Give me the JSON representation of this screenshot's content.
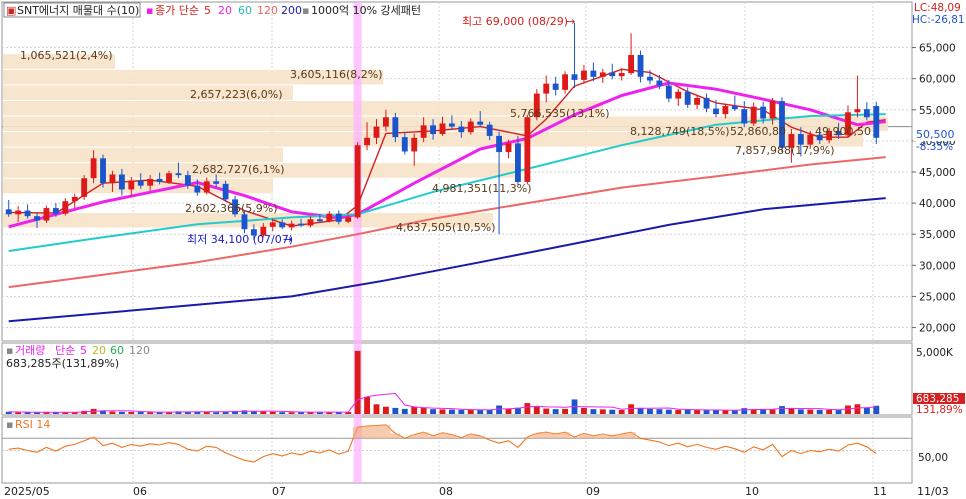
{
  "header": {
    "title": "SNT에너지 매물대 수(10)",
    "ma_label": "종가 단순",
    "ma_periods": [
      "5",
      "20",
      "60",
      "120",
      "200"
    ],
    "ma_colors": [
      "#d32020",
      "#ee22ee",
      "#22cccc",
      "#ee6666",
      "#1a1aaa"
    ],
    "pattern_label": "1000억 10% 강세패턴",
    "lc": "LC:48,09",
    "hc": "HC:-26,81"
  },
  "price_axis": {
    "ticks": [
      "65,000",
      "60,000",
      "55,000",
      "50,000",
      "45,000",
      "40,000",
      "35,000",
      "30,000",
      "25,000",
      "20,000"
    ],
    "current_price": "50,500",
    "current_change": "-8.35%"
  },
  "annotations": {
    "high": "최고 69,000 (08/29)",
    "low": "최저 34,100 (07/07)"
  },
  "volume_profile_labels": [
    "1,065,521(2,4%)",
    "3,605,116(8,2%)",
    "2,657,223(6,0%)",
    "5,766,535(13,1%)",
    "8,128,749(18,5%)",
    "52,860,80",
    "49,900,50",
    "7,857,988(17,9%)",
    "2,682,727(6,1%)",
    "4,981,351(11,3%)",
    "2,602,366(5,9%)",
    "4,637,505(10,5%)"
  ],
  "volume_panel": {
    "title": "거래량",
    "ma_label": "단순",
    "ma_periods": [
      "5",
      "20",
      "60",
      "120"
    ],
    "ma_colors": [
      "#ee22ee",
      "#cccc22",
      "#22aa55",
      "#888888"
    ],
    "value_line": "683,285주(131,89%)",
    "axis_tick": "5,000K",
    "last_value": "683,285",
    "last_pct": "131,89%"
  },
  "rsi_panel": {
    "title": "RSI 14",
    "axis_tick": "50,00"
  },
  "x_axis": {
    "labels": [
      "2025/05",
      "06",
      "07",
      "08",
      "09",
      "10",
      "11",
      "11/03"
    ]
  },
  "chart_data": {
    "type": "candlestick",
    "title": "SNT에너지 매물대 수(10)",
    "ylim": [
      18000,
      72000
    ],
    "y_ticks": [
      20000,
      25000,
      30000,
      35000,
      40000,
      45000,
      50000,
      55000,
      60000,
      65000
    ],
    "high": 69000,
    "low": 34100,
    "last_close": 50500,
    "candles": [
      {
        "o": 39000,
        "h": 40500,
        "l": 37800,
        "c": 38200
      },
      {
        "o": 38200,
        "h": 39500,
        "l": 37000,
        "c": 38800
      },
      {
        "o": 38800,
        "h": 39800,
        "l": 37500,
        "c": 37900
      },
      {
        "o": 37900,
        "h": 38500,
        "l": 36000,
        "c": 37200
      },
      {
        "o": 37200,
        "h": 39600,
        "l": 36800,
        "c": 39200
      },
      {
        "o": 39200,
        "h": 40000,
        "l": 37800,
        "c": 38300
      },
      {
        "o": 38300,
        "h": 40800,
        "l": 38000,
        "c": 40300
      },
      {
        "o": 40300,
        "h": 41500,
        "l": 39200,
        "c": 41000
      },
      {
        "o": 41000,
        "h": 44500,
        "l": 40500,
        "c": 44000
      },
      {
        "o": 44000,
        "h": 48500,
        "l": 43200,
        "c": 47200
      },
      {
        "o": 47200,
        "h": 47800,
        "l": 42500,
        "c": 43200
      },
      {
        "o": 43200,
        "h": 45200,
        "l": 41800,
        "c": 44600
      },
      {
        "o": 44600,
        "h": 45500,
        "l": 41200,
        "c": 42200
      },
      {
        "o": 42200,
        "h": 44200,
        "l": 41000,
        "c": 43600
      },
      {
        "o": 43600,
        "h": 44800,
        "l": 42300,
        "c": 42800
      },
      {
        "o": 42800,
        "h": 44500,
        "l": 42000,
        "c": 43900
      },
      {
        "o": 43900,
        "h": 44900,
        "l": 43000,
        "c": 43400
      },
      {
        "o": 43400,
        "h": 45200,
        "l": 43100,
        "c": 44800
      },
      {
        "o": 44800,
        "h": 46500,
        "l": 44000,
        "c": 44500
      },
      {
        "o": 44500,
        "h": 45200,
        "l": 42300,
        "c": 42800
      },
      {
        "o": 42800,
        "h": 43800,
        "l": 41200,
        "c": 41700
      },
      {
        "o": 41700,
        "h": 44100,
        "l": 41400,
        "c": 43500
      },
      {
        "o": 43500,
        "h": 44600,
        "l": 42600,
        "c": 43100
      },
      {
        "o": 43100,
        "h": 43600,
        "l": 40200,
        "c": 40600
      },
      {
        "o": 40600,
        "h": 41200,
        "l": 37800,
        "c": 38200
      },
      {
        "o": 38200,
        "h": 38800,
        "l": 35200,
        "c": 35800
      },
      {
        "o": 35800,
        "h": 36600,
        "l": 34100,
        "c": 34800
      },
      {
        "o": 34800,
        "h": 36800,
        "l": 34500,
        "c": 36200
      },
      {
        "o": 36200,
        "h": 37500,
        "l": 35500,
        "c": 36900
      },
      {
        "o": 36900,
        "h": 37400,
        "l": 35800,
        "c": 36100
      },
      {
        "o": 36100,
        "h": 37200,
        "l": 35600,
        "c": 36700
      },
      {
        "o": 36700,
        "h": 37500,
        "l": 36200,
        "c": 36400
      },
      {
        "o": 36400,
        "h": 37900,
        "l": 36100,
        "c": 37400
      },
      {
        "o": 37400,
        "h": 38200,
        "l": 36800,
        "c": 37100
      },
      {
        "o": 37100,
        "h": 38700,
        "l": 36900,
        "c": 38300
      },
      {
        "o": 38300,
        "h": 38800,
        "l": 36600,
        "c": 37000
      },
      {
        "o": 37000,
        "h": 38100,
        "l": 36800,
        "c": 37700
      },
      {
        "o": 37700,
        "h": 49800,
        "l": 37500,
        "c": 49300
      },
      {
        "o": 49300,
        "h": 53000,
        "l": 48500,
        "c": 50500
      },
      {
        "o": 50500,
        "h": 53500,
        "l": 49500,
        "c": 52300
      },
      {
        "o": 52300,
        "h": 55000,
        "l": 51500,
        "c": 53800
      },
      {
        "o": 53800,
        "h": 54500,
        "l": 49800,
        "c": 50600
      },
      {
        "o": 50600,
        "h": 51500,
        "l": 47800,
        "c": 48300
      },
      {
        "o": 48300,
        "h": 51200,
        "l": 46000,
        "c": 50500
      },
      {
        "o": 50500,
        "h": 53800,
        "l": 49800,
        "c": 52500
      },
      {
        "o": 52500,
        "h": 53500,
        "l": 50200,
        "c": 51100
      },
      {
        "o": 51100,
        "h": 53900,
        "l": 50800,
        "c": 52800
      },
      {
        "o": 52800,
        "h": 54100,
        "l": 51800,
        "c": 52300
      },
      {
        "o": 52300,
        "h": 53200,
        "l": 50500,
        "c": 51400
      },
      {
        "o": 51400,
        "h": 53600,
        "l": 51000,
        "c": 53100
      },
      {
        "o": 53100,
        "h": 54800,
        "l": 52200,
        "c": 52600
      },
      {
        "o": 52600,
        "h": 53100,
        "l": 50100,
        "c": 50800
      },
      {
        "o": 50800,
        "h": 51500,
        "l": 35000,
        "c": 48200
      },
      {
        "o": 48200,
        "h": 50200,
        "l": 47200,
        "c": 49600
      },
      {
        "o": 49600,
        "h": 50800,
        "l": 42800,
        "c": 43400
      },
      {
        "o": 43400,
        "h": 54200,
        "l": 43000,
        "c": 53800
      },
      {
        "o": 53800,
        "h": 58300,
        "l": 53300,
        "c": 57600
      },
      {
        "o": 57600,
        "h": 60500,
        "l": 56200,
        "c": 59200
      },
      {
        "o": 59200,
        "h": 60300,
        "l": 57300,
        "c": 58200
      },
      {
        "o": 58200,
        "h": 61200,
        "l": 57600,
        "c": 60700
      },
      {
        "o": 60700,
        "h": 69000,
        "l": 58500,
        "c": 59800
      },
      {
        "o": 59800,
        "h": 62200,
        "l": 59200,
        "c": 61300
      },
      {
        "o": 61300,
        "h": 62600,
        "l": 59600,
        "c": 60300
      },
      {
        "o": 60300,
        "h": 61600,
        "l": 59300,
        "c": 61000
      },
      {
        "o": 61000,
        "h": 62400,
        "l": 59900,
        "c": 60400
      },
      {
        "o": 60400,
        "h": 61700,
        "l": 59700,
        "c": 60900
      },
      {
        "o": 60900,
        "h": 67300,
        "l": 60600,
        "c": 63800
      },
      {
        "o": 63800,
        "h": 64500,
        "l": 59400,
        "c": 60300
      },
      {
        "o": 60300,
        "h": 61400,
        "l": 59100,
        "c": 59700
      },
      {
        "o": 59700,
        "h": 60600,
        "l": 58300,
        "c": 58900
      },
      {
        "o": 58900,
        "h": 59800,
        "l": 56200,
        "c": 56800
      },
      {
        "o": 56800,
        "h": 58400,
        "l": 55600,
        "c": 57900
      },
      {
        "o": 57900,
        "h": 58600,
        "l": 55300,
        "c": 55800
      },
      {
        "o": 55800,
        "h": 57400,
        "l": 55100,
        "c": 56900
      },
      {
        "o": 56900,
        "h": 57600,
        "l": 54600,
        "c": 55200
      },
      {
        "o": 55200,
        "h": 56600,
        "l": 53800,
        "c": 54300
      },
      {
        "o": 54300,
        "h": 56000,
        "l": 53600,
        "c": 55600
      },
      {
        "o": 55600,
        "h": 57300,
        "l": 54800,
        "c": 55100
      },
      {
        "o": 55100,
        "h": 56400,
        "l": 52200,
        "c": 52800
      },
      {
        "o": 52800,
        "h": 56200,
        "l": 52400,
        "c": 55500
      },
      {
        "o": 55500,
        "h": 56300,
        "l": 52800,
        "c": 53600
      },
      {
        "o": 53600,
        "h": 56900,
        "l": 52600,
        "c": 56400
      },
      {
        "o": 56400,
        "h": 57000,
        "l": 48200,
        "c": 48900
      },
      {
        "o": 48900,
        "h": 51900,
        "l": 46500,
        "c": 51100
      },
      {
        "o": 51100,
        "h": 52200,
        "l": 47500,
        "c": 49400
      },
      {
        "o": 49400,
        "h": 51600,
        "l": 48700,
        "c": 51000
      },
      {
        "o": 51000,
        "h": 52100,
        "l": 49500,
        "c": 50100
      },
      {
        "o": 50100,
        "h": 52100,
        "l": 49600,
        "c": 51600
      },
      {
        "o": 51600,
        "h": 52900,
        "l": 50300,
        "c": 50900
      },
      {
        "o": 50900,
        "h": 55700,
        "l": 50600,
        "c": 54600
      },
      {
        "o": 54600,
        "h": 60500,
        "l": 53800,
        "c": 55100
      },
      {
        "o": 55100,
        "h": 56200,
        "l": 53300,
        "c": 53800
      },
      {
        "o": 55600,
        "h": 56300,
        "l": 49500,
        "c": 50500
      }
    ],
    "moving_averages": [
      {
        "name": "5",
        "color": "#d32020",
        "values": [
          [
            0,
            38500
          ],
          [
            5,
            38400
          ],
          [
            10,
            43200
          ],
          [
            15,
            43700
          ],
          [
            20,
            42700
          ],
          [
            25,
            38800
          ],
          [
            30,
            36300
          ],
          [
            35,
            37300
          ],
          [
            37,
            39600
          ],
          [
            40,
            51200
          ],
          [
            45,
            51600
          ],
          [
            50,
            52300
          ],
          [
            55,
            50800
          ],
          [
            57,
            53500
          ],
          [
            60,
            58800
          ],
          [
            65,
            61500
          ],
          [
            68,
            61000
          ],
          [
            72,
            57900
          ],
          [
            75,
            56100
          ],
          [
            80,
            55000
          ],
          [
            83,
            52200
          ],
          [
            86,
            50600
          ],
          [
            89,
            50600
          ],
          [
            91,
            53000
          ],
          [
            93,
            53400
          ]
        ]
      },
      {
        "name": "20",
        "color": "#ee22ee",
        "values": [
          [
            0,
            36200
          ],
          [
            10,
            40200
          ],
          [
            20,
            43300
          ],
          [
            25,
            41200
          ],
          [
            30,
            38600
          ],
          [
            35,
            37600
          ],
          [
            37,
            38200
          ],
          [
            43,
            43200
          ],
          [
            50,
            48700
          ],
          [
            55,
            50400
          ],
          [
            60,
            54200
          ],
          [
            65,
            57300
          ],
          [
            70,
            59300
          ],
          [
            75,
            58300
          ],
          [
            80,
            56700
          ],
          [
            85,
            55000
          ],
          [
            90,
            52600
          ],
          [
            93,
            53100
          ]
        ]
      },
      {
        "name": "60",
        "color": "#22cccc",
        "values": [
          [
            0,
            32300
          ],
          [
            10,
            34500
          ],
          [
            20,
            36600
          ],
          [
            30,
            37700
          ],
          [
            37,
            38200
          ],
          [
            45,
            41800
          ],
          [
            55,
            45500
          ],
          [
            65,
            49300
          ],
          [
            75,
            52600
          ],
          [
            85,
            54000
          ],
          [
            93,
            54300
          ]
        ]
      },
      {
        "name": "120",
        "color": "#ee6666",
        "values": [
          [
            0,
            26500
          ],
          [
            10,
            28500
          ],
          [
            20,
            30500
          ],
          [
            30,
            33000
          ],
          [
            37,
            35000
          ],
          [
            45,
            37500
          ],
          [
            55,
            40000
          ],
          [
            65,
            42500
          ],
          [
            75,
            44300
          ],
          [
            85,
            46200
          ],
          [
            93,
            47400
          ]
        ]
      },
      {
        "name": "200",
        "color": "#1a1aaa",
        "values": [
          [
            0,
            21000
          ],
          [
            15,
            23000
          ],
          [
            30,
            25000
          ],
          [
            40,
            27600
          ],
          [
            50,
            30500
          ],
          [
            60,
            33500
          ],
          [
            70,
            36500
          ],
          [
            80,
            39000
          ],
          [
            93,
            40800
          ]
        ]
      }
    ],
    "volume_profile": [
      {
        "low": 61500,
        "high": 64000,
        "label": "1,065,521(2,4%)"
      },
      {
        "low": 59000,
        "high": 61500,
        "label": "3,605,116(8,2%)"
      },
      {
        "low": 56500,
        "high": 59000,
        "label": "2,657,223(6,0%)"
      },
      {
        "low": 54000,
        "high": 56500,
        "label": "5,766,535(13,1%)"
      },
      {
        "low": 51500,
        "high": 54000,
        "label": "8,128,749(18,5%)"
      },
      {
        "low": 49000,
        "high": 51500,
        "label": "7,857,988(17,9%)"
      },
      {
        "low": 46500,
        "high": 49000,
        "label": "2,682,727(6,1%)"
      },
      {
        "low": 44000,
        "high": 46500,
        "label": "4,981,351(11,3%)"
      },
      {
        "low": 41500,
        "high": 44000,
        "label": "2,602,366(5,9%)"
      },
      {
        "low": 36000,
        "high": 38500,
        "label": "4,637,505(10,5%)"
      }
    ],
    "highlight_index": 37,
    "volume": {
      "unit": "K",
      "ylim": [
        0,
        5600
      ],
      "values": [
        180,
        150,
        140,
        120,
        170,
        130,
        160,
        150,
        260,
        420,
        300,
        200,
        180,
        170,
        160,
        150,
        140,
        150,
        220,
        200,
        180,
        170,
        150,
        210,
        260,
        300,
        240,
        200,
        180,
        150,
        140,
        160,
        150,
        170,
        160,
        150,
        170,
        5200,
        1400,
        800,
        600,
        500,
        420,
        600,
        500,
        400,
        380,
        360,
        340,
        330,
        320,
        350,
        700,
        450,
        520,
        900,
        600,
        450,
        400,
        420,
        1200,
        500,
        400,
        380,
        350,
        330,
        800,
        500,
        420,
        400,
        360,
        340,
        350,
        330,
        320,
        300,
        310,
        300,
        480,
        420,
        400,
        360,
        650,
        480,
        380,
        360,
        340,
        330,
        320,
        700,
        800,
        500,
        680
      ]
    },
    "rsi": {
      "period": 14,
      "ylim": [
        0,
        100
      ],
      "values": [
        52,
        54,
        50,
        47,
        55,
        49,
        57,
        60,
        66,
        72,
        58,
        62,
        55,
        60,
        57,
        61,
        59,
        63,
        60,
        52,
        49,
        57,
        55,
        46,
        40,
        34,
        31,
        40,
        45,
        41,
        46,
        43,
        49,
        46,
        51,
        44,
        49,
        88,
        90,
        91,
        92,
        78,
        70,
        76,
        80,
        74,
        79,
        76,
        71,
        77,
        74,
        67,
        62,
        66,
        55,
        72,
        78,
        80,
        77,
        80,
        72,
        78,
        74,
        77,
        74,
        77,
        80,
        70,
        67,
        64,
        58,
        62,
        56,
        60,
        55,
        52,
        57,
        53,
        47,
        56,
        51,
        60,
        40,
        50,
        45,
        50,
        48,
        52,
        49,
        59,
        62,
        56,
        45
      ]
    }
  }
}
